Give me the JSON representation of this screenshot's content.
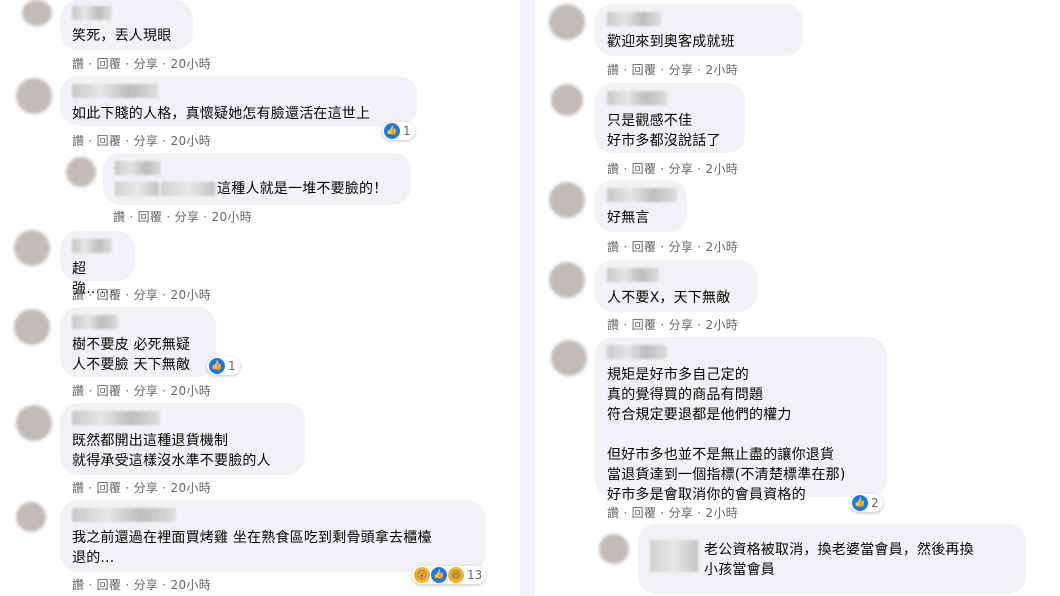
{
  "left": [
    {
      "text": "笑死，丟人現眼",
      "actions": "讚 · 回覆 · 分享 · 20小時"
    },
    {
      "text": "如此下賤的人格，真懷疑她怎有臉還活在這世上",
      "actions": "讚 · 回覆 · 分享 · 20小時",
      "reaction": {
        "count": "1"
      }
    },
    {
      "text": "這種人就是一堆不要臉的！",
      "actions": "讚 · 回覆 · 分享 · 20小時"
    },
    {
      "text": "超強......",
      "actions": "讚 · 回覆 · 分享 · 20小時"
    },
    {
      "text": "樹不要皮 必死無疑\n人不要臉 天下無敵",
      "actions": "讚 · 回覆 · 分享 · 20小時",
      "reaction": {
        "count": "1"
      }
    },
    {
      "text": "既然都開出這種退貨機制\n就得承受這樣沒水準不要臉的人",
      "actions": "讚 · 回覆 · 分享 · 20小時"
    },
    {
      "text": "我之前還過在裡面買烤雞 坐在熟食區吃到剩骨頭拿去櫃檯\n退的...",
      "actions": "讚 · 回覆 · 分享 · 20小時",
      "reaction": {
        "count": "13"
      }
    }
  ],
  "right": [
    {
      "text": "歡迎來到奧客成就班",
      "actions": "讚 · 回覆 · 分享 · 2小時"
    },
    {
      "text": "只是觀感不佳\n好市多都沒說話了",
      "actions": "讚 · 回覆 · 分享 · 2小時"
    },
    {
      "text": "好無言",
      "actions": "讚 · 回覆 · 分享 · 2小時"
    },
    {
      "text": "人不要X，天下無敵",
      "actions": "讚 · 回覆 · 分享 · 2小時"
    },
    {
      "text": "規矩是好市多自己定的\n真的覺得買的商品有問題\n符合規定要退都是他們的權力\n\n但好市多也並不是無止盡的讓你退貨\n當退貨達到一個指標(不清楚標準在那)\n好市多是會取消你的會員資格的",
      "actions": "讚 · 回覆 · 分享 · 2小時",
      "reaction": {
        "count": "2"
      }
    },
    {
      "text": "老公資格被取消，換老婆當會員，然後再換\n小孩當會員"
    }
  ],
  "icons": {
    "like": "like-icon",
    "wow": "wow-icon",
    "haha": "haha-icon"
  },
  "colors": {
    "bubble": "#f0f2f5",
    "meta": "#65676b",
    "like": "#1877f2"
  }
}
